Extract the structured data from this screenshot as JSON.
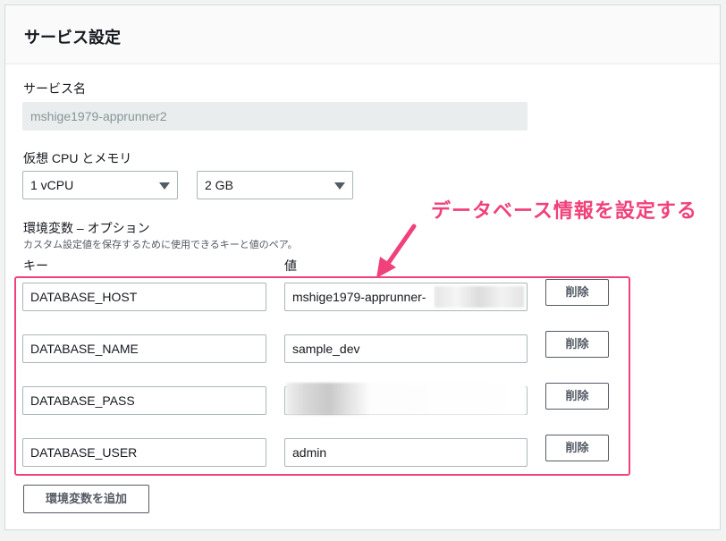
{
  "panel": {
    "title": "サービス設定"
  },
  "service_name": {
    "label": "サービス名",
    "value": "mshige1979-apprunner2"
  },
  "vcpu_memory": {
    "label": "仮想 CPU とメモリ",
    "cpu": "1 vCPU",
    "memory": "2 GB"
  },
  "env": {
    "label": "環境変数 – オプション",
    "description": "カスタム設定値を保存するために使用できるキーと値のペア。",
    "key_header": "キー",
    "value_header": "値",
    "delete_label": "削除",
    "add_label": "環境変数を追加",
    "rows": [
      {
        "key": "DATABASE_HOST",
        "value": "mshige1979-apprunner-"
      },
      {
        "key": "DATABASE_NAME",
        "value": "sample_dev"
      },
      {
        "key": "DATABASE_PASS",
        "value": ""
      },
      {
        "key": "DATABASE_USER",
        "value": "admin"
      }
    ]
  },
  "annotation": {
    "text": "データベース情報を設定する",
    "color": "#f0417a"
  },
  "colors": {
    "accent": "#f0417a",
    "border": "#aab7b8",
    "text": "#16191f"
  }
}
